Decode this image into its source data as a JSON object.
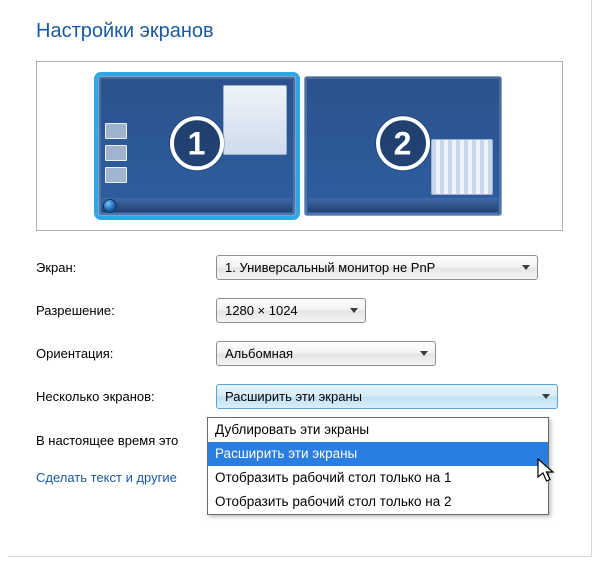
{
  "title": "Настройки экранов",
  "monitors": {
    "primary": "1",
    "secondary": "2"
  },
  "fields": {
    "display": {
      "label": "Экран:",
      "value": "1. Универсальный монитор не PnP"
    },
    "resolution": {
      "label": "Разрешение:",
      "value": "1280 × 1024"
    },
    "orientation": {
      "label": "Ориентация:",
      "value": "Альбомная"
    },
    "multi": {
      "label": "Несколько экранов:",
      "value": "Расширить эти экраны"
    }
  },
  "multi_options": [
    "Дублировать эти экраны",
    "Расширить эти экраны",
    "Отобразить рабочий стол только на 1",
    "Отобразить рабочий стол только на 2"
  ],
  "multi_selected_index": 1,
  "notice_truncated": "В настоящее время это",
  "link_truncated": "Сделать текст и другие"
}
